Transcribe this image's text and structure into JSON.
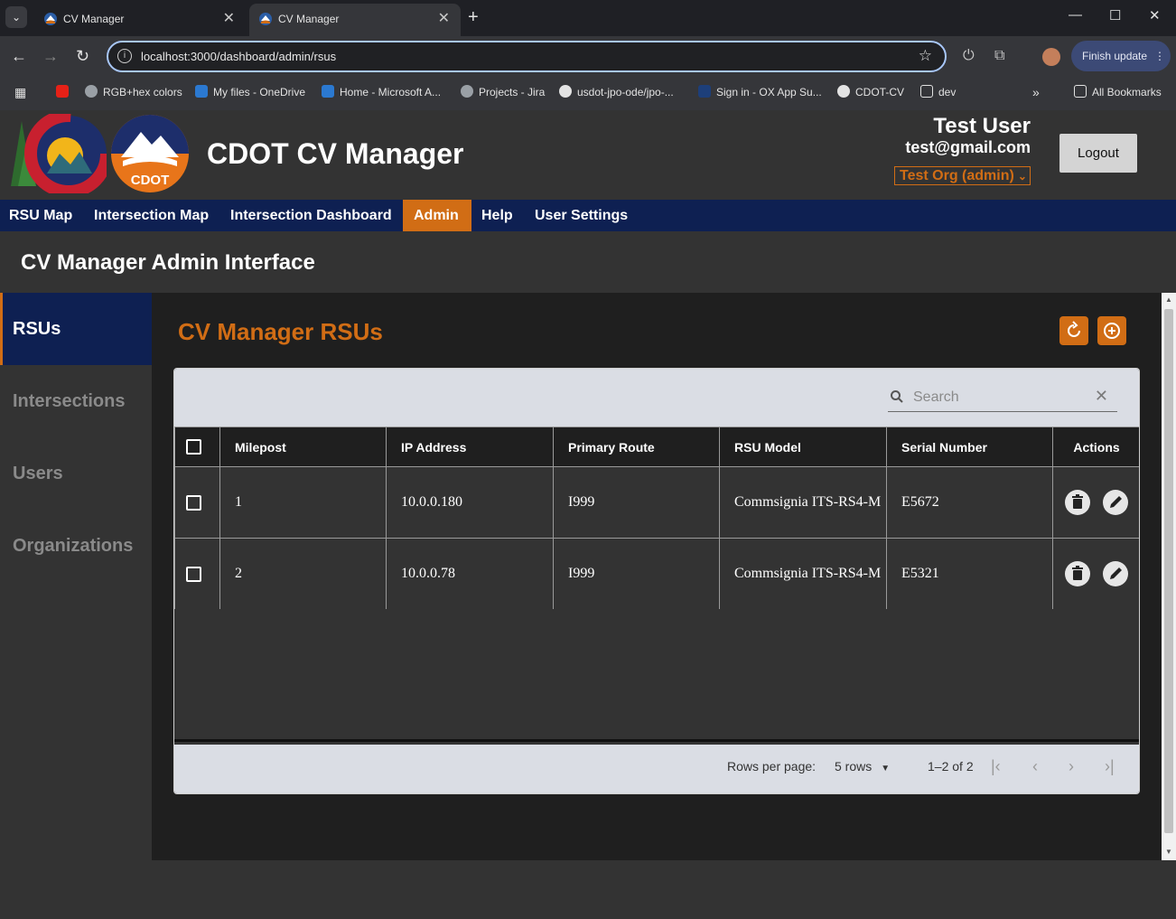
{
  "browser": {
    "tabs": [
      {
        "title": "CV Manager",
        "active": false
      },
      {
        "title": "CV Manager",
        "active": true
      }
    ],
    "url": "localhost:3000/dashboard/admin/rsus",
    "finish_update": "Finish update",
    "bookmarks": [
      "RGB+hex colors",
      "My files - OneDrive",
      "Home - Microsoft A...",
      "Projects - Jira",
      "usdot-jpo-ode/jpo-...",
      "Sign in - OX App Su...",
      "CDOT-CV",
      "dev"
    ],
    "all_bookmarks": "All Bookmarks",
    "overflow": "»"
  },
  "header": {
    "title": "CDOT CV Manager",
    "logo_text": "CDOT",
    "user_name": "Test User",
    "user_email": "test@gmail.com",
    "org_select": "Test Org (admin)",
    "logout": "Logout"
  },
  "nav": {
    "items": [
      "RSU Map",
      "Intersection Map",
      "Intersection Dashboard",
      "Admin",
      "Help",
      "User Settings"
    ],
    "active": "Admin"
  },
  "admin": {
    "title": "CV Manager Admin Interface"
  },
  "sidebar": {
    "items": [
      "RSUs",
      "Intersections",
      "Users",
      "Organizations"
    ],
    "active": "RSUs"
  },
  "main": {
    "section_title": "CV Manager RSUs",
    "search_placeholder": "Search",
    "columns": [
      "Milepost",
      "IP Address",
      "Primary Route",
      "RSU Model",
      "Serial Number",
      "Actions"
    ],
    "rows": [
      {
        "milepost": "1",
        "ip": "10.0.0.180",
        "route": "I999",
        "model": "Commsignia ITS-RS4-M",
        "serial": "E5672"
      },
      {
        "milepost": "2",
        "ip": "10.0.0.78",
        "route": "I999",
        "model": "Commsignia ITS-RS4-M",
        "serial": "E5321"
      }
    ],
    "pager": {
      "rows_per_page_label": "Rows per page:",
      "rows_per_page_value": "5 rows",
      "range": "1–2 of 2"
    }
  },
  "colors": {
    "accent": "#d16d15",
    "nav_bg": "#0e2052",
    "header_bg": "#333333"
  }
}
